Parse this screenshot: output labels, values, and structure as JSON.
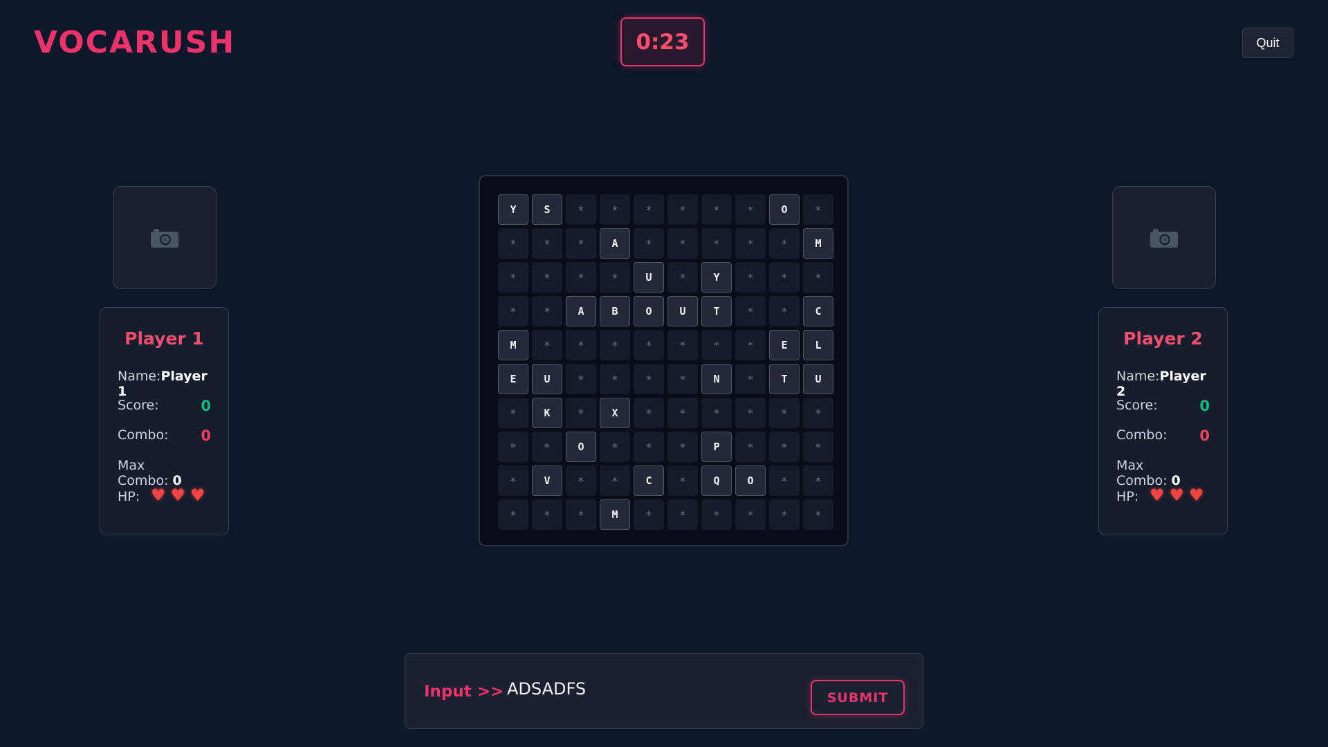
{
  "app": {
    "logo": "VOCARUSH",
    "timer": "0:23",
    "quit_label": "Quit"
  },
  "players": [
    {
      "title": "Player 1",
      "name_label": "Name:",
      "name": "Player 1",
      "score_label": "Score:",
      "score": "0",
      "combo_label": "Combo:",
      "combo": "0",
      "max_combo_label": "Max Combo:",
      "max_combo": "0",
      "hp_label": "HP:",
      "hp": 3,
      "heart": "♥"
    },
    {
      "title": "Player 2",
      "name_label": "Name:",
      "name": "Player 2",
      "score_label": "Score:",
      "score": "0",
      "combo_label": "Combo:",
      "combo": "0",
      "max_combo_label": "Max Combo:",
      "max_combo": "0",
      "hp_label": "HP:",
      "hp": 3,
      "heart": "♥"
    }
  ],
  "avatar_icon": "camera-icon",
  "board": {
    "hidden_symbol": "*",
    "rows": [
      [
        "Y",
        "S",
        "*",
        "*",
        "*",
        "*",
        "*",
        "*",
        "O",
        "*"
      ],
      [
        "*",
        "*",
        "*",
        "A",
        "*",
        "*",
        "*",
        "*",
        "*",
        "M"
      ],
      [
        "*",
        "*",
        "*",
        "*",
        "U",
        "*",
        "Y",
        "*",
        "*",
        "*"
      ],
      [
        "*",
        "*",
        "A",
        "B",
        "O",
        "U",
        "T",
        "*",
        "*",
        "C"
      ],
      [
        "M",
        "*",
        "*",
        "*",
        "*",
        "*",
        "*",
        "*",
        "E",
        "L"
      ],
      [
        "E",
        "U",
        "*",
        "*",
        "*",
        "*",
        "N",
        "*",
        "T",
        "U"
      ],
      [
        "*",
        "K",
        "*",
        "X",
        "*",
        "*",
        "*",
        "*",
        "*",
        "*"
      ],
      [
        "*",
        "*",
        "O",
        "*",
        "*",
        "*",
        "P",
        "*",
        "*",
        "*"
      ],
      [
        "*",
        "V",
        "*",
        "*",
        "C",
        "*",
        "Q",
        "O",
        "*",
        "*"
      ],
      [
        "*",
        "*",
        "*",
        "M",
        "*",
        "*",
        "*",
        "*",
        "*",
        "*"
      ]
    ]
  },
  "input": {
    "label": "Input >>",
    "value": "ADSADFS",
    "submit_label": "SUBMIT"
  },
  "colors": {
    "accent": "#e9336a",
    "background": "#0f172a",
    "score": "#10b981",
    "combo": "#f43f5e",
    "heart": "#ef4444"
  }
}
